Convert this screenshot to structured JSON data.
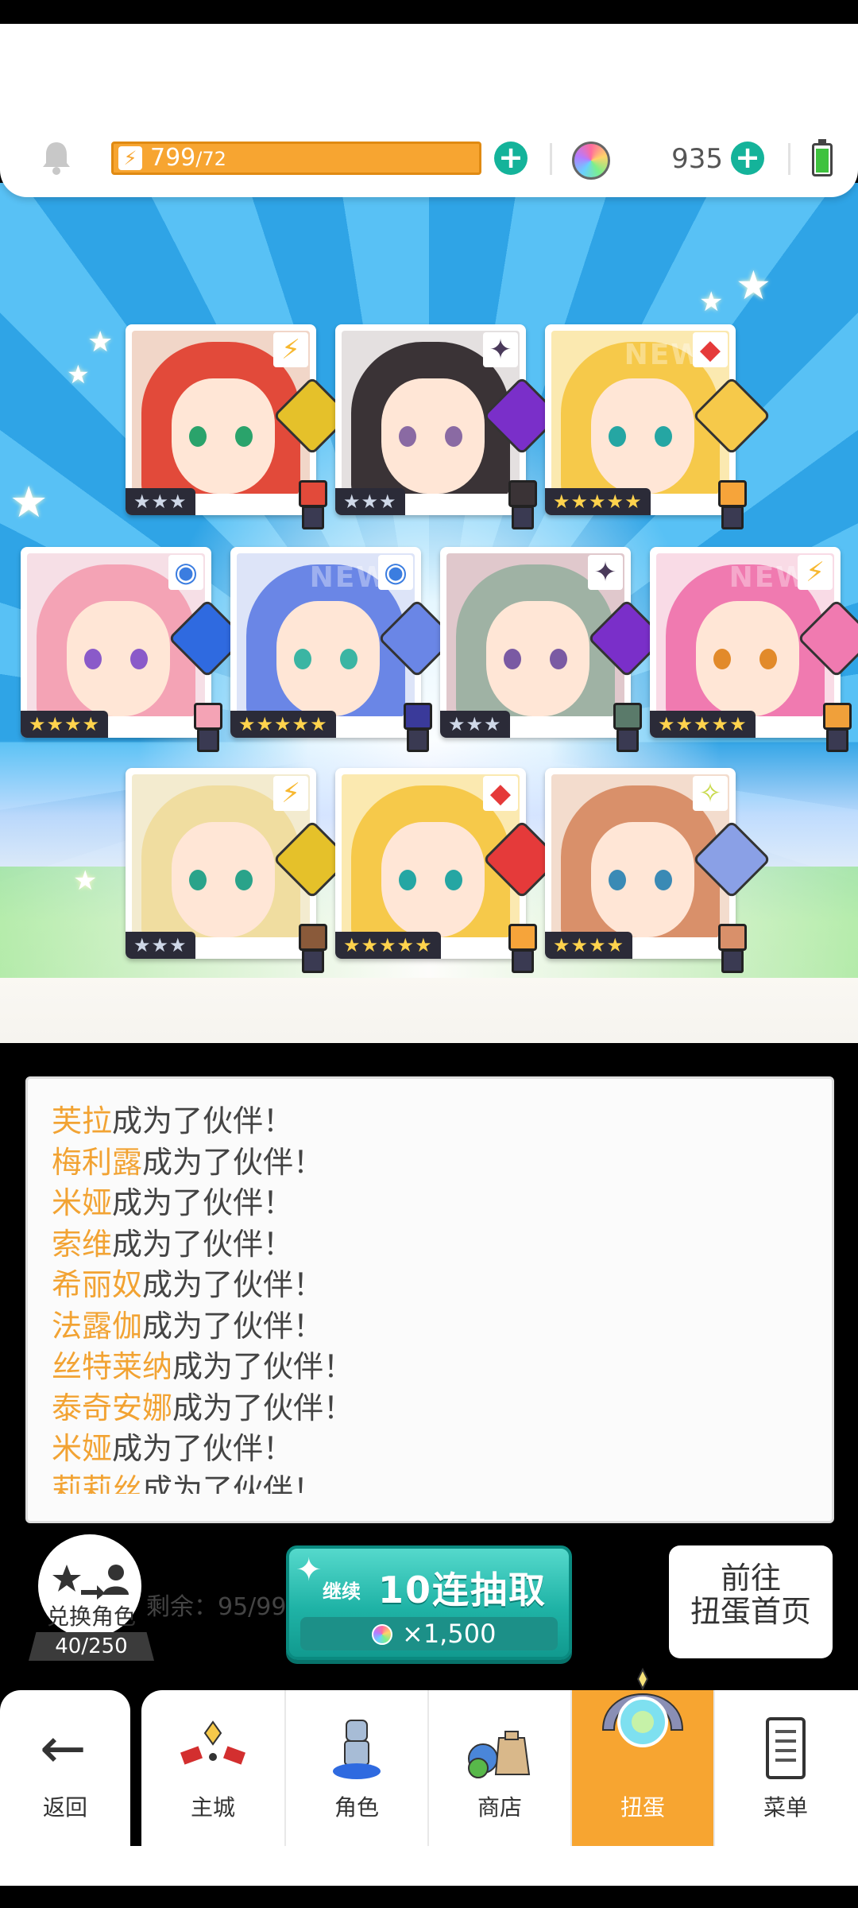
{
  "header": {
    "energy_current": "799",
    "energy_max": "/72",
    "gem_count": "935"
  },
  "cards": [
    {
      "stars": "★★★",
      "element": "lightning",
      "element_glyph": "⚡",
      "element_color": "#f7b830",
      "rarity": "silver",
      "hair": "#e24a3a",
      "bg": "#f1d6c8",
      "eyes": "#2aa36b",
      "weapon": "#e5c12a",
      "chibi": "#e24a3a"
    },
    {
      "stars": "★★★",
      "element": "dark",
      "element_glyph": "✦",
      "element_color": "#4a3a5a",
      "rarity": "silver",
      "hair": "#3a3336",
      "bg": "#e4e0e0",
      "eyes": "#8a6aa3",
      "weapon": "#7a2fc9",
      "chibi": "#3a3336"
    },
    {
      "stars": "★★★★★",
      "element": "fire",
      "element_glyph": "◆",
      "element_color": "#e53a3a",
      "rarity": "gold",
      "hair": "#f6c94a",
      "bg": "#fbe9b0",
      "eyes": "#25a6a3",
      "weapon": "#f6c94a",
      "chibi": "#f6a43a"
    },
    {
      "stars": "★★★★",
      "element": "water",
      "element_glyph": "◉",
      "element_color": "#3b7de0",
      "rarity": "gold",
      "hair": "#f4a3b5",
      "bg": "#f6dfe6",
      "eyes": "#8a5ac9",
      "weapon": "#2f6ae0",
      "chibi": "#f4a3b5"
    },
    {
      "stars": "★★★★★",
      "element": "water",
      "element_glyph": "◉",
      "element_color": "#3b7de0",
      "rarity": "gold",
      "hair": "#6a86e6",
      "bg": "#dde4f8",
      "eyes": "#3bb5a3",
      "weapon": "#6a86e6",
      "chibi": "#3a3a9a"
    },
    {
      "stars": "★★★",
      "element": "dark",
      "element_glyph": "✦",
      "element_color": "#4a3a5a",
      "rarity": "silver",
      "hair": "#9fb2a4",
      "bg": "#e0c8cc",
      "eyes": "#7a5aa3",
      "weapon": "#7a2fc9",
      "chibi": "#5a7a6a"
    },
    {
      "stars": "★★★★★",
      "element": "lightning",
      "element_glyph": "⚡",
      "element_color": "#f7b830",
      "rarity": "gold",
      "hair": "#f07ab0",
      "bg": "#f9dbe6",
      "eyes": "#e28a2a",
      "weapon": "#f07ab0",
      "chibi": "#f0a03a"
    },
    {
      "stars": "★★★",
      "element": "lightning",
      "element_glyph": "⚡",
      "element_color": "#f7b830",
      "rarity": "silver",
      "hair": "#f0dda0",
      "bg": "#f3ebcf",
      "eyes": "#2aa38a",
      "weapon": "#e5c12a",
      "chibi": "#8a5a3a"
    },
    {
      "stars": "★★★★★",
      "element": "fire",
      "element_glyph": "◆",
      "element_color": "#e53a3a",
      "rarity": "gold",
      "hair": "#f6c94a",
      "bg": "#fbe9b0",
      "eyes": "#25a6a3",
      "weapon": "#e53a3a",
      "chibi": "#f6a43a"
    },
    {
      "stars": "★★★★",
      "element": "light",
      "element_glyph": "✧",
      "element_color": "#c8d94a",
      "rarity": "gold",
      "hair": "#d9906a",
      "bg": "#f3dccd",
      "eyes": "#3a8ab5",
      "weapon": "#8aa0e6",
      "chibi": "#d9906a"
    }
  ],
  "log": [
    {
      "name": "芙拉",
      "text": "成为了伙伴！"
    },
    {
      "name": "梅利露",
      "text": "成为了伙伴！"
    },
    {
      "name": "米娅",
      "text": "成为了伙伴！"
    },
    {
      "name": "索维",
      "text": "成为了伙伴！"
    },
    {
      "name": "希丽奴",
      "text": "成为了伙伴！"
    },
    {
      "name": "法露伽",
      "text": "成为了伙伴！"
    },
    {
      "name": "丝特莱纳",
      "text": "成为了伙伴！"
    },
    {
      "name": "泰奇安娜",
      "text": "成为了伙伴！"
    },
    {
      "name": "米娅",
      "text": "成为了伙伴！"
    },
    {
      "name": "莉莉丝",
      "text": "成为了伙伴！"
    }
  ],
  "exchange": {
    "label": "兑换角色",
    "count": "40/250"
  },
  "remaining": "剩余：95/99",
  "draw": {
    "continue_label": "继续",
    "main_label": "10连抽取",
    "cost": "×1,500"
  },
  "goto": {
    "line1": "前往",
    "line2": "扭蛋首页"
  },
  "tabs": {
    "back": "返回",
    "items": [
      {
        "label": "主城",
        "icon": "castle-icon"
      },
      {
        "label": "角色",
        "icon": "character-icon"
      },
      {
        "label": "商店",
        "icon": "shop-icon"
      },
      {
        "label": "扭蛋",
        "icon": "gacha-icon",
        "active": true
      },
      {
        "label": "菜单",
        "icon": "menu-icon"
      }
    ]
  },
  "colors": {
    "accent": "#f7a531",
    "teal": "#1fb3a6",
    "name_orange": "#f2a333"
  }
}
